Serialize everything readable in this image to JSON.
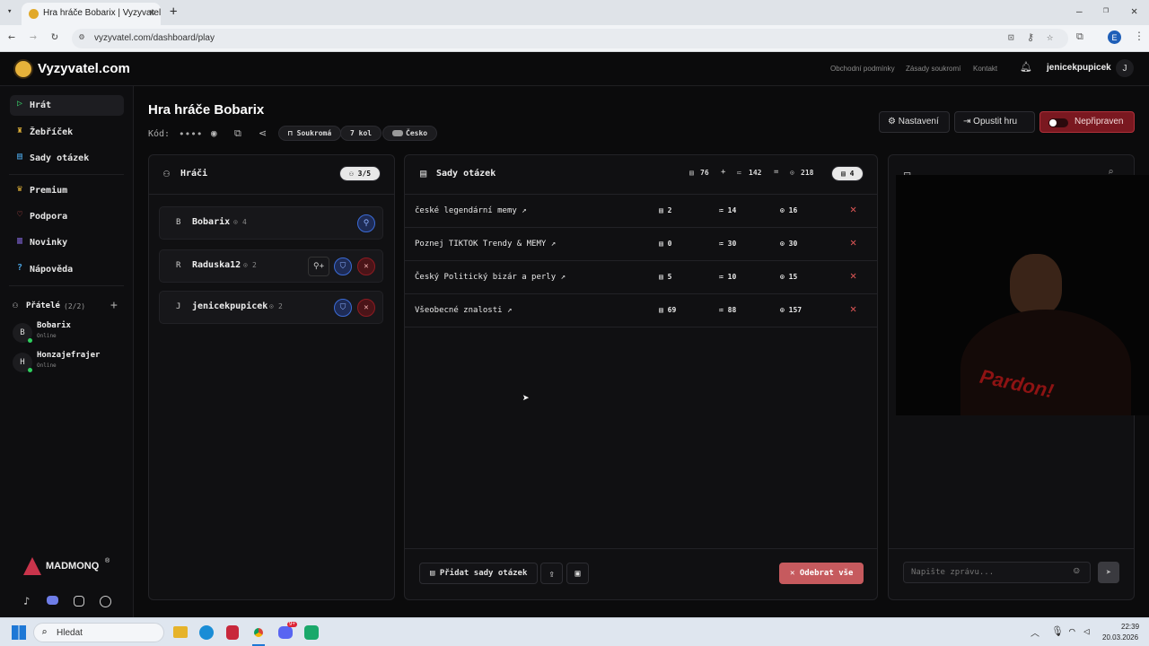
{
  "browser": {
    "tab_title": "Hra hráče Bobarix | Vyzyvatel.co",
    "url": "vyzyvatel.com/dashboard/play",
    "profile": "E"
  },
  "header": {
    "logo": "Vyzyvatel.com",
    "links": [
      "Obchodní podmínky",
      "Zásady soukromí",
      "Kontakt"
    ],
    "username": "jenicekpupicek",
    "avatar": "J"
  },
  "sidebar": {
    "nav": [
      "Hrát",
      "Žebříček",
      "Sady otázek",
      "Premium",
      "Podpora",
      "Novinky",
      "Nápověda"
    ],
    "friends_label": "Přátelé",
    "friends_count": "(2/2)",
    "friends": [
      {
        "avatar": "B",
        "name": "Bobarix",
        "status": "Online"
      },
      {
        "avatar": "H",
        "name": "Honzajefrajer",
        "status": "Online"
      }
    ],
    "brand": "MADMONQ",
    "brand_mark": "®"
  },
  "game": {
    "title": "Hra hráče Bobarix",
    "code_label": "Kód:",
    "code": "••••",
    "privacy": "Soukromá",
    "rounds": "7 kol",
    "region": "Česko",
    "settings_btn": "Nastavení",
    "leave_btn": "Opustit hru",
    "ready_btn": "Nepřipraven"
  },
  "players": {
    "title": "Hráči",
    "count": "3/5",
    "rows": [
      {
        "avatar": "B",
        "name": "Bobarix",
        "level": "4"
      },
      {
        "avatar": "R",
        "name": "Raduska12",
        "level": "2"
      },
      {
        "avatar": "J",
        "name": "jenicekpupicek",
        "level": "2"
      }
    ]
  },
  "sets": {
    "title": "Sady otázek",
    "stat_a": "76",
    "plus": "+",
    "stat_b": "142",
    "eq": "=",
    "stat_total": "218",
    "stat_sets": "4",
    "rows": [
      {
        "name": "české legendární memy",
        "a": "2",
        "b": "14",
        "c": "16"
      },
      {
        "name": "Poznej TIKTOK Trendy & MEMY",
        "a": "0",
        "b": "30",
        "c": "30"
      },
      {
        "name": "Český Politický bizár a perly",
        "a": "5",
        "b": "10",
        "c": "15"
      },
      {
        "name": "Všeobecné znalosti",
        "a": "69",
        "b": "88",
        "c": "157"
      }
    ],
    "add_btn": "Přidat sady otázek",
    "remove_btn": "Odebrat vše"
  },
  "chat": {
    "placeholder": "Napište zprávu...",
    "webcam_text": "Pardon!"
  },
  "taskbar": {
    "search": "Hledat",
    "time": "22:39",
    "date": "20.03.2026",
    "badge": "9+"
  },
  "colors": {
    "accent": "#e45a5a",
    "ready_red": "#8e1b22",
    "player_blue": "#3b6bd6"
  }
}
